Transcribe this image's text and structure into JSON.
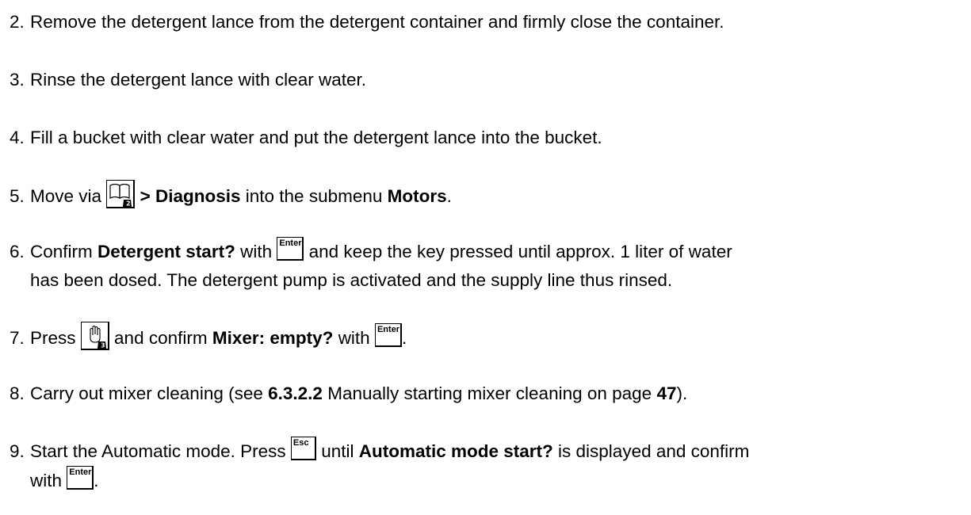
{
  "steps": [
    {
      "num": "2.",
      "text": "Remove the detergent lance from the detergent container and firmly close the container."
    },
    {
      "num": "3.",
      "text": "Rinse the detergent lance with clear water."
    },
    {
      "num": "4.",
      "text": "Fill a bucket with clear water and put the detergent lance into the bucket."
    },
    {
      "num": "5.",
      "pre": "Move via",
      "bold1": "> Diagnosis",
      "mid": "into the submenu",
      "bold2": "Motors",
      "end": "."
    },
    {
      "num": "6.",
      "pre": "Confirm",
      "bold1": "Detergent start?",
      "mid": "with",
      "after": "and keep the key pressed until approx. 1 liter of water",
      "line2": "has been dosed. The detergent pump is activated and the supply line thus rinsed."
    },
    {
      "num": "7.",
      "pre": "Press",
      "mid": "and confirm",
      "bold1": "Mixer: empty?",
      "mid2": "with",
      "end": "."
    },
    {
      "num": "8.",
      "pre": "Carry out mixer cleaning (see",
      "bold1": "6.3.2.2",
      "mid": "Manually starting mixer cleaning on page",
      "bold2": "47",
      "end": ")."
    },
    {
      "num": "9.",
      "pre": "Start the Automatic mode. Press",
      "mid": "until",
      "bold1": "Automatic mode start?",
      "after": "is displayed and confirm",
      "line2": "with",
      "end": "."
    }
  ],
  "keys": {
    "enter": "Enter",
    "esc": "Esc"
  },
  "icons": {
    "manual_book": "book-icon",
    "manual_hand": "hand-icon"
  }
}
